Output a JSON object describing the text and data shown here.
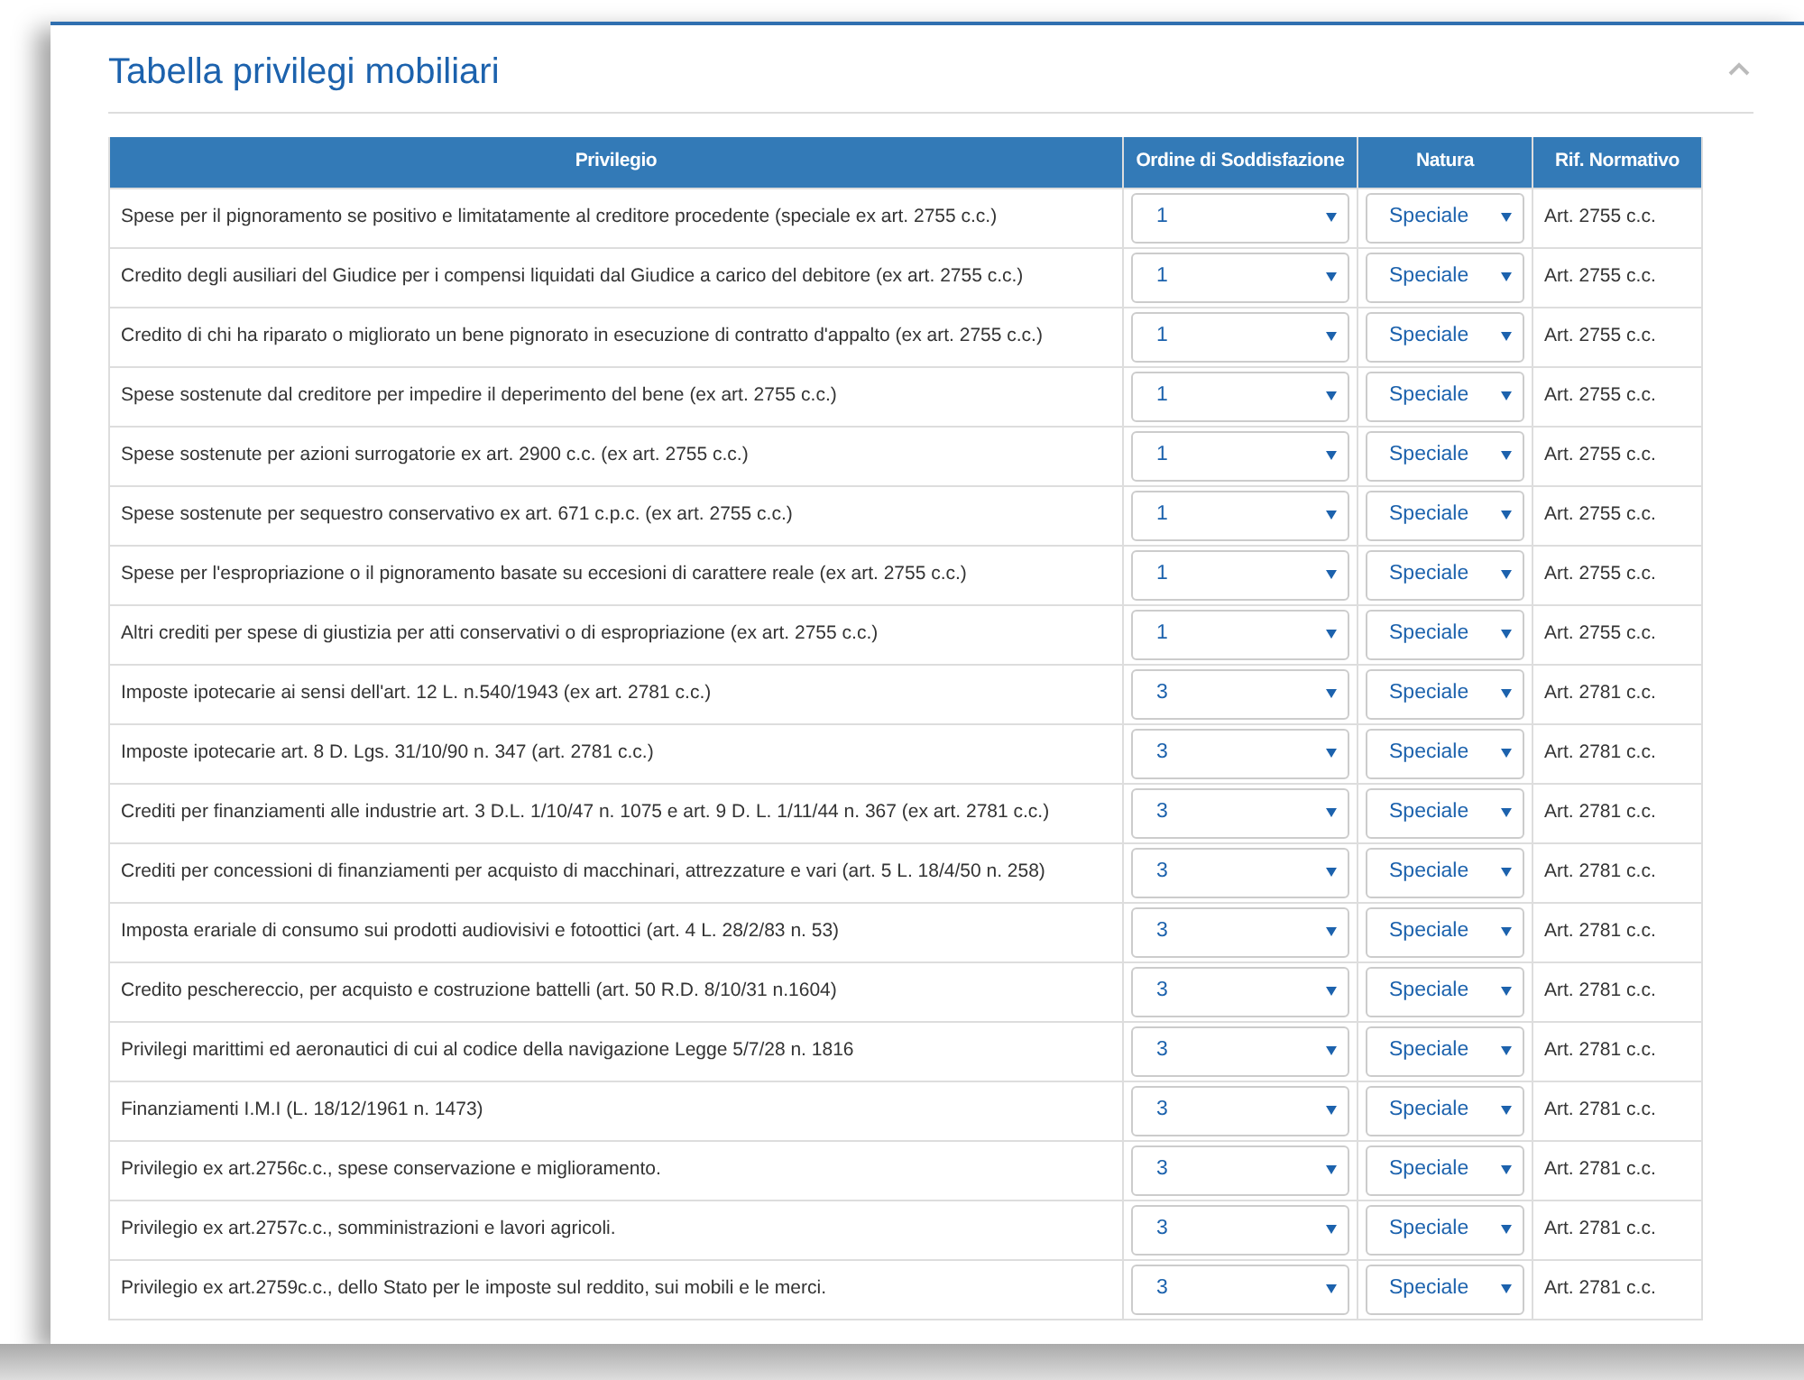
{
  "panel": {
    "title": "Tabella privilegi mobiliari",
    "collapsed": false
  },
  "table": {
    "columns": [
      "Privilegio",
      "Ordine di Soddisfazione",
      "Natura",
      "Rif. Normativo"
    ],
    "rows": [
      {
        "privilegio": "Spese per il pignoramento se positivo e limitatamente al creditore procedente (speciale ex art. 2755 c.c.)",
        "ordine": "1",
        "natura": "Speciale",
        "rif": "Art. 2755 c.c."
      },
      {
        "privilegio": "Credito degli ausiliari del Giudice per i compensi liquidati dal Giudice a carico del debitore (ex art. 2755 c.c.)",
        "ordine": "1",
        "natura": "Speciale",
        "rif": "Art. 2755 c.c."
      },
      {
        "privilegio": "Credito di chi ha riparato o migliorato un bene pignorato in esecuzione di contratto d'appalto (ex art. 2755 c.c.)",
        "ordine": "1",
        "natura": "Speciale",
        "rif": "Art. 2755 c.c."
      },
      {
        "privilegio": "Spese sostenute dal creditore per impedire il deperimento del bene (ex art. 2755 c.c.)",
        "ordine": "1",
        "natura": "Speciale",
        "rif": "Art. 2755 c.c."
      },
      {
        "privilegio": "Spese sostenute per azioni surrogatorie ex art. 2900 c.c. (ex art. 2755 c.c.)",
        "ordine": "1",
        "natura": "Speciale",
        "rif": "Art. 2755 c.c."
      },
      {
        "privilegio": "Spese sostenute per sequestro conservativo ex art. 671 c.p.c. (ex art. 2755 c.c.)",
        "ordine": "1",
        "natura": "Speciale",
        "rif": "Art. 2755 c.c."
      },
      {
        "privilegio": "Spese per l'espropriazione o il pignoramento basate su eccesioni di carattere reale (ex art. 2755 c.c.)",
        "ordine": "1",
        "natura": "Speciale",
        "rif": "Art. 2755 c.c."
      },
      {
        "privilegio": "Altri crediti per spese di giustizia per atti conservativi o di espropriazione (ex art. 2755 c.c.)",
        "ordine": "1",
        "natura": "Speciale",
        "rif": "Art. 2755 c.c."
      },
      {
        "privilegio": "Imposte ipotecarie ai sensi dell'art. 12 L. n.540/1943 (ex art. 2781 c.c.)",
        "ordine": "3",
        "natura": "Speciale",
        "rif": "Art. 2781 c.c."
      },
      {
        "privilegio": "Imposte ipotecarie art. 8 D. Lgs. 31/10/90 n. 347 (art. 2781 c.c.)",
        "ordine": "3",
        "natura": "Speciale",
        "rif": "Art. 2781 c.c."
      },
      {
        "privilegio": "Crediti per finanziamenti alle industrie art. 3 D.L. 1/10/47 n. 1075 e art. 9 D. L. 1/11/44 n. 367 (ex art. 2781 c.c.)",
        "ordine": "3",
        "natura": "Speciale",
        "rif": "Art. 2781 c.c."
      },
      {
        "privilegio": "Crediti per concessioni di finanziamenti per acquisto di macchinari, attrezzature e vari (art. 5 L. 18/4/50 n. 258)",
        "ordine": "3",
        "natura": "Speciale",
        "rif": "Art. 2781 c.c."
      },
      {
        "privilegio": "Imposta erariale di consumo sui prodotti audiovisivi e fotoottici (art. 4 L. 28/2/83 n. 53)",
        "ordine": "3",
        "natura": "Speciale",
        "rif": "Art. 2781 c.c."
      },
      {
        "privilegio": "Credito peschereccio, per acquisto e costruzione battelli (art. 50 R.D. 8/10/31 n.1604)",
        "ordine": "3",
        "natura": "Speciale",
        "rif": "Art. 2781 c.c."
      },
      {
        "privilegio": "Privilegi marittimi ed aeronautici di cui al codice della navigazione Legge 5/7/28 n. 1816",
        "ordine": "3",
        "natura": "Speciale",
        "rif": "Art. 2781 c.c."
      },
      {
        "privilegio": "Finanziamenti I.M.I (L. 18/12/1961 n. 1473)",
        "ordine": "3",
        "natura": "Speciale",
        "rif": "Art. 2781 c.c."
      },
      {
        "privilegio": "Privilegio ex art.2756c.c., spese conservazione e miglioramento.",
        "ordine": "3",
        "natura": "Speciale",
        "rif": "Art. 2781 c.c."
      },
      {
        "privilegio": "Privilegio ex art.2757c.c., somministrazioni e lavori agricoli.",
        "ordine": "3",
        "natura": "Speciale",
        "rif": "Art. 2781 c.c."
      },
      {
        "privilegio": "Privilegio ex art.2759c.c., dello Stato per le imposte sul reddito, sui mobili e le merci.",
        "ordine": "3",
        "natura": "Speciale",
        "rif": "Art. 2781 c.c."
      }
    ]
  }
}
